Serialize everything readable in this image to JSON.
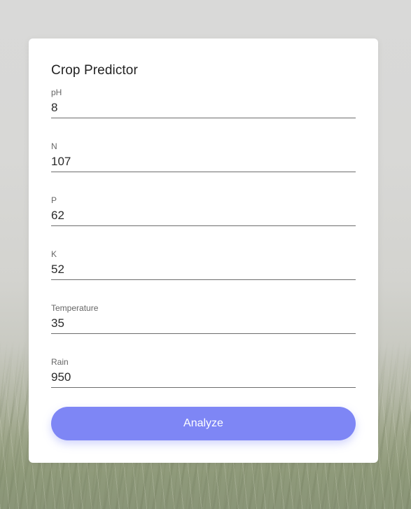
{
  "form": {
    "title": "Crop Predictor",
    "fields": [
      {
        "label": "pH",
        "value": "8"
      },
      {
        "label": "N",
        "value": "107"
      },
      {
        "label": "P",
        "value": "62"
      },
      {
        "label": "K",
        "value": "52"
      },
      {
        "label": "Temperature",
        "value": "35"
      },
      {
        "label": "Rain",
        "value": "950"
      }
    ],
    "submit_label": "Analyze"
  },
  "colors": {
    "button": "#7e86f5",
    "card": "#ffffff",
    "underline": "#6d6d6d"
  }
}
